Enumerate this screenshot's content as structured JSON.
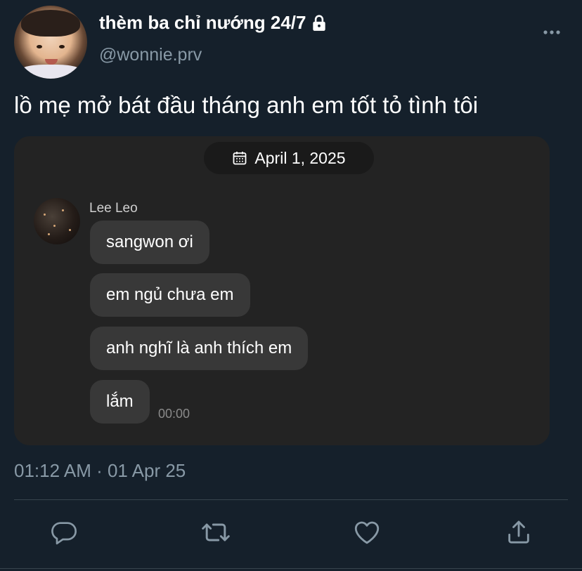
{
  "tweet": {
    "display_name": "thèm ba chỉ nướng 24/7",
    "handle": "@wonnie.prv",
    "text": "lồ mẹ mở bát đầu tháng anh em tốt tỏ tình tôi",
    "timestamp": "01:12 AM · 01 Apr 25",
    "more_icon": "more-horizontal-icon",
    "lock_icon": "lock-icon"
  },
  "chat": {
    "date": "April 1, 2025",
    "sender": "Lee Leo",
    "messages": [
      "sangwon ơi",
      "em ngủ chưa em",
      "anh nghĩ là anh thích em",
      "lắm"
    ],
    "time": "00:00"
  },
  "actions": [
    {
      "name": "reply",
      "icon": "reply-icon"
    },
    {
      "name": "retweet",
      "icon": "retweet-icon"
    },
    {
      "name": "like",
      "icon": "heart-icon"
    },
    {
      "name": "share",
      "icon": "share-icon"
    }
  ],
  "colors": {
    "background": "#15202b",
    "secondary_text": "#8899a6",
    "card": "#232323",
    "bubble": "#383838",
    "divider": "#38444d"
  }
}
